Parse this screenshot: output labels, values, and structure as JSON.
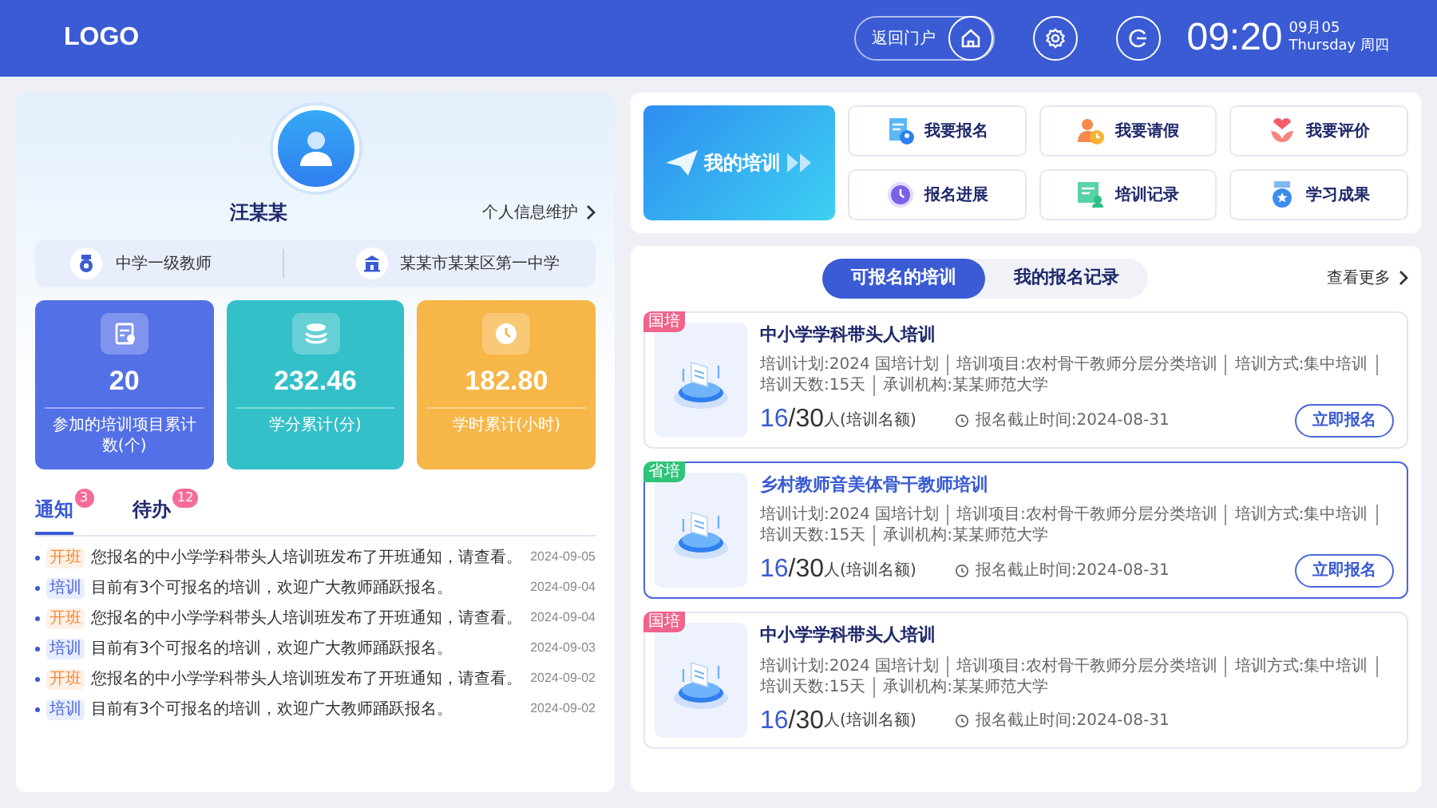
{
  "header": {
    "logo": "LOGO",
    "portal_button": "返回门户",
    "time": "09:20",
    "date": "09月05",
    "weekday": "Thursday 周四"
  },
  "profile": {
    "name": "汪某某",
    "edit_link": "个人信息维护",
    "title": "中学一级教师",
    "school": "某某市某某区第一中学"
  },
  "stats": [
    {
      "kind": "projects",
      "value": "20",
      "label": "参加的培训项目累计数(个)"
    },
    {
      "kind": "credits",
      "value": "232.46",
      "label": "学分累计(分)"
    },
    {
      "kind": "hours",
      "value": "182.80",
      "label": "学时累计(小时)"
    }
  ],
  "notice_tabs": [
    {
      "label": "通知",
      "count": "3",
      "selected": true
    },
    {
      "label": "待办",
      "count": "12",
      "selected": false
    }
  ],
  "notices": [
    {
      "kind": "open",
      "tag": "开班",
      "text": "您报名的中小学学科带头人培训班发布了开班通知，请查看。",
      "date": "2024-09-05"
    },
    {
      "kind": "training",
      "tag": "培训",
      "text": "目前有3个可报名的培训，欢迎广大教师踊跃报名。",
      "date": "2024-09-04"
    },
    {
      "kind": "open",
      "tag": "开班",
      "text": "您报名的中小学学科带头人培训班发布了开班通知，请查看。",
      "date": "2024-09-04"
    },
    {
      "kind": "training",
      "tag": "培训",
      "text": "目前有3个可报名的培训，欢迎广大教师踊跃报名。",
      "date": "2024-09-03"
    },
    {
      "kind": "open",
      "tag": "开班",
      "text": "您报名的中小学学科带头人培训班发布了开班通知，请查看。",
      "date": "2024-09-02"
    },
    {
      "kind": "training",
      "tag": "培训",
      "text": "目前有3个可报名的培训，欢迎广大教师踊跃报名。",
      "date": "2024-09-02"
    }
  ],
  "banner": {
    "title": "我的培训"
  },
  "quick_links": [
    {
      "kind": "signup",
      "label": "我要报名"
    },
    {
      "kind": "leave",
      "label": "我要请假"
    },
    {
      "kind": "review",
      "label": "我要评价"
    },
    {
      "kind": "progress",
      "label": "报名进展"
    },
    {
      "kind": "record",
      "label": "培训记录"
    },
    {
      "kind": "result",
      "label": "学习成果"
    }
  ],
  "course_tabs": [
    {
      "label": "可报名的培训",
      "selected": true
    },
    {
      "label": "我的报名记录",
      "selected": false
    }
  ],
  "more_link": "查看更多",
  "courses": [
    {
      "tag": "国培",
      "color": "#f0638a",
      "title": "中小学学科带头人培训",
      "selected": false,
      "meta": [
        "培训计划:2024 国培计划",
        "培训项目:农村骨干教师分层分类培训",
        "培训方式:集中培训",
        "培训天数:15天",
        "承训机构:某某师范大学"
      ],
      "enrolled": "16",
      "quota": "/30",
      "quota_unit": "人(培训名额)",
      "deadline": "报名截止时间:2024-08-31",
      "button": "立即报名"
    },
    {
      "tag": "省培",
      "color": "#2fc37a",
      "title": "乡村教师音美体骨干教师培训",
      "selected": true,
      "meta": [
        "培训计划:2024 国培计划",
        "培训项目:农村骨干教师分层分类培训",
        "培训方式:集中培训",
        "培训天数:15天",
        "承训机构:某某师范大学"
      ],
      "enrolled": "16",
      "quota": "/30",
      "quota_unit": "人(培训名额)",
      "deadline": "报名截止时间:2024-08-31",
      "button": "立即报名"
    },
    {
      "tag": "国培",
      "color": "#f0638a",
      "title": "中小学学科带头人培训",
      "selected": false,
      "meta": [
        "培训计划:2024 国培计划",
        "培训项目:农村骨干教师分层分类培训",
        "培训方式:集中培训",
        "培训天数:15天",
        "承训机构:某某师范大学"
      ],
      "enrolled": "16",
      "quota": "/30",
      "quota_unit": "人(培训名额)",
      "deadline": "报名截止时间:2024-08-31"
    }
  ]
}
